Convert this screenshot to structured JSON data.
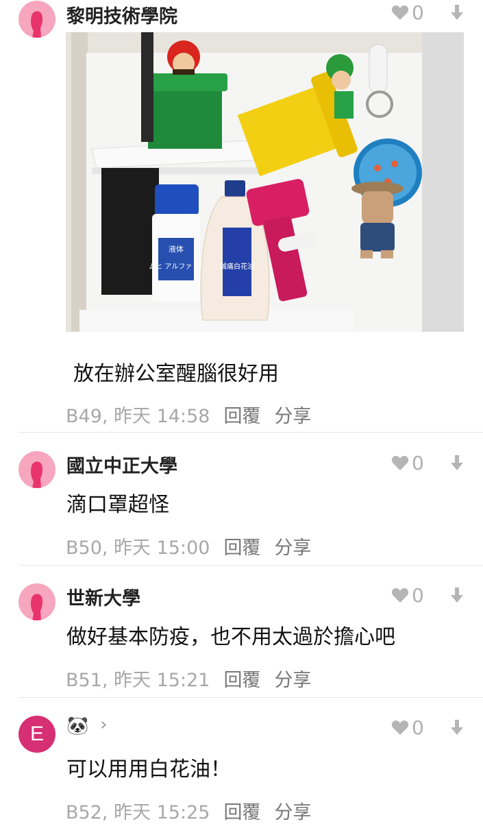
{
  "comments": [
    {
      "author": "黎明技術學院",
      "likes": "0",
      "body": "放在辦公室醒腦很好用",
      "floor_time": "B49, 昨天 14:58",
      "reply_label": "回覆",
      "share_label": "分享",
      "has_image": true
    },
    {
      "author": "國立中正大學",
      "likes": "0",
      "body": "滴口罩超怪",
      "floor_time": "B50, 昨天 15:00",
      "reply_label": "回覆",
      "share_label": "分享"
    },
    {
      "author": "世新大學",
      "likes": "0",
      "body": "做好基本防疫，也不用太過於擔心吧",
      "floor_time": "B51, 昨天 15:21",
      "reply_label": "回覆",
      "share_label": "分享"
    },
    {
      "author": "🐼",
      "avatar_letter": "E",
      "likes": "0",
      "body": "可以用用白花油！",
      "floor_time": "B52, 昨天 15:25",
      "reply_label": "回覆",
      "share_label": "分享"
    }
  ],
  "photo_labels": {
    "bottle_left": "ムヒ アルファ EX",
    "bottle_left_tag": "液体",
    "bottle_center": "滅痛白花油"
  },
  "colors": {
    "avatar_pink": "#f7a6c0",
    "avatar_letter_bg": "#d62f74",
    "meta_gray": "#a8a8a8"
  }
}
